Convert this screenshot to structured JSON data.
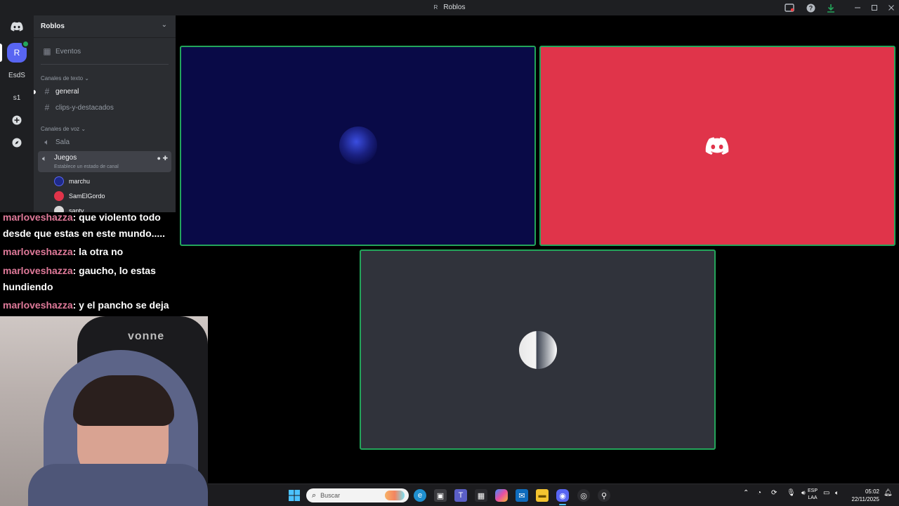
{
  "window": {
    "title": "Roblos",
    "title_initial": "R"
  },
  "rail": {
    "home_icon": "discord-icon",
    "servers": [
      {
        "label": "R",
        "active": true
      },
      {
        "label": "EsdS"
      },
      {
        "label": "s1"
      }
    ],
    "add_icon": "plus-icon",
    "explore_icon": "compass-icon"
  },
  "sidebar": {
    "server_name": "Roblos",
    "events_label": "Eventos",
    "text_category": "Canales de texto",
    "text_channels": [
      "general",
      "clips-y-destacados"
    ],
    "voice_category": "Canales de voz",
    "voice_channels": [
      "Sala",
      "Juegos"
    ],
    "voice_status": "Establece un estado de canal",
    "members": [
      "marchu",
      "SamElGordo",
      "santy"
    ]
  },
  "chat": {
    "messages": [
      {
        "user": "marloveshazza",
        "text": ": que violento todo desde que estas en este mundo....."
      },
      {
        "user": "marloveshazza",
        "text": ": la otra no"
      },
      {
        "user": "marloveshazza",
        "text": ": gaucho, lo estas hundiendo"
      },
      {
        "user": "marloveshazza",
        "text": ": y el pancho se deja"
      }
    ]
  },
  "webcam": {
    "chair_brand": "vonne"
  },
  "tiles": [
    {
      "color": "#090a47",
      "avatar": "user-avatar"
    },
    {
      "color": "#e0344a",
      "avatar": "discord-icon"
    },
    {
      "color": "#30333b",
      "avatar": "user-avatar"
    }
  ],
  "taskbar": {
    "search_placeholder": "Buscar",
    "lang_primary": "ESP",
    "lang_secondary": "LAA",
    "time": "05:02",
    "date": "22/11/2025"
  },
  "colors": {
    "accent": "#5865f2",
    "speaking": "#23a55a",
    "username": "#e07a9a"
  }
}
